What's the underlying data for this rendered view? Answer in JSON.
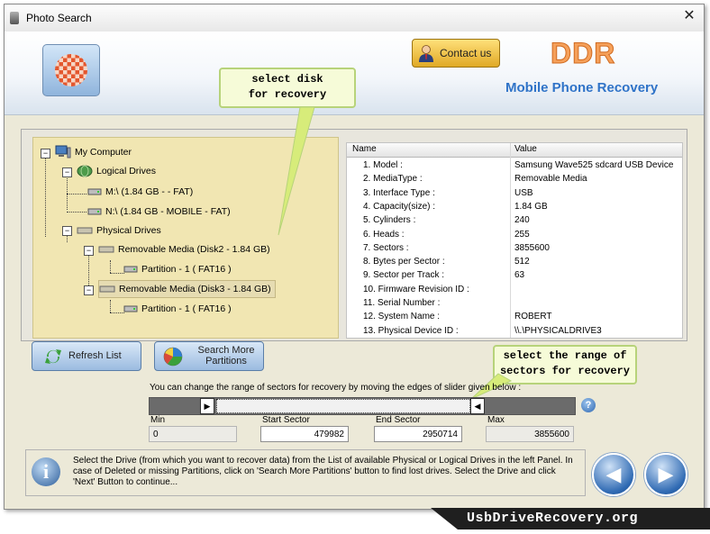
{
  "window": {
    "title": "Photo Search",
    "close_glyph": "✕"
  },
  "header": {
    "contact_label": "Contact us",
    "brand": "DDR",
    "subtitle": "Mobile Phone Recovery"
  },
  "callouts": {
    "select_disk": [
      "select disk",
      "for recovery"
    ],
    "select_range": [
      "select the range of",
      "sectors for recovery"
    ]
  },
  "tree": {
    "root": "My Computer",
    "logical_label": "Logical Drives",
    "logical": [
      "M:\\ (1.84 GB -  - FAT)",
      "N:\\ (1.84 GB - MOBILE - FAT)"
    ],
    "physical_label": "Physical Drives",
    "disks": [
      {
        "label": "Removable Media (Disk2 - 1.84 GB)",
        "partition": "Partition - 1 ( FAT16 )"
      },
      {
        "label": "Removable Media (Disk3 - 1.84 GB)",
        "partition": "Partition - 1 ( FAT16 )"
      }
    ]
  },
  "grid": {
    "columns": [
      "Name",
      "Value"
    ],
    "rows": [
      [
        "1. Model :",
        "Samsung Wave525 sdcard USB Device"
      ],
      [
        "2. MediaType :",
        "Removable Media"
      ],
      [
        "3. Interface Type :",
        "USB"
      ],
      [
        "4. Capacity(size) :",
        "1.84 GB"
      ],
      [
        "5. Cylinders :",
        "240"
      ],
      [
        "6. Heads :",
        "255"
      ],
      [
        "7. Sectors :",
        "3855600"
      ],
      [
        "8. Bytes per Sector :",
        "512"
      ],
      [
        "9. Sector per Track :",
        "63"
      ],
      [
        "10. Firmware Revision ID :",
        ""
      ],
      [
        "11. Serial Number :",
        ""
      ],
      [
        "12. System Name :",
        "ROBERT"
      ],
      [
        "13. Physical Device ID :",
        "\\\\.\\PHYSICALDRIVE3"
      ]
    ]
  },
  "buttons": {
    "refresh": "Refresh List",
    "search_more": [
      "Search More",
      "Partitions"
    ]
  },
  "range": {
    "instruction": "You can change the range of sectors for recovery by moving the edges of slider given below :",
    "min_label": "Min",
    "min_value": "0",
    "start_label": "Start Sector",
    "start_value": "479982",
    "end_label": "End Sector",
    "end_value": "2950714",
    "max_label": "Max",
    "max_value": "3855600",
    "help_glyph": "?"
  },
  "info": {
    "icon_glyph": "i",
    "text": "Select the Drive (from which you want to recover data) from the List of available Physical or Logical Drives in the left Panel. In case of Deleted or missing Partitions, click on 'Search More Partitions' button to find lost drives. Select the Drive and click 'Next' Button to continue..."
  },
  "nav": {
    "back_glyph": "◀",
    "next_glyph": "▶"
  },
  "footer": {
    "site": "UsbDriveRecovery.org"
  }
}
